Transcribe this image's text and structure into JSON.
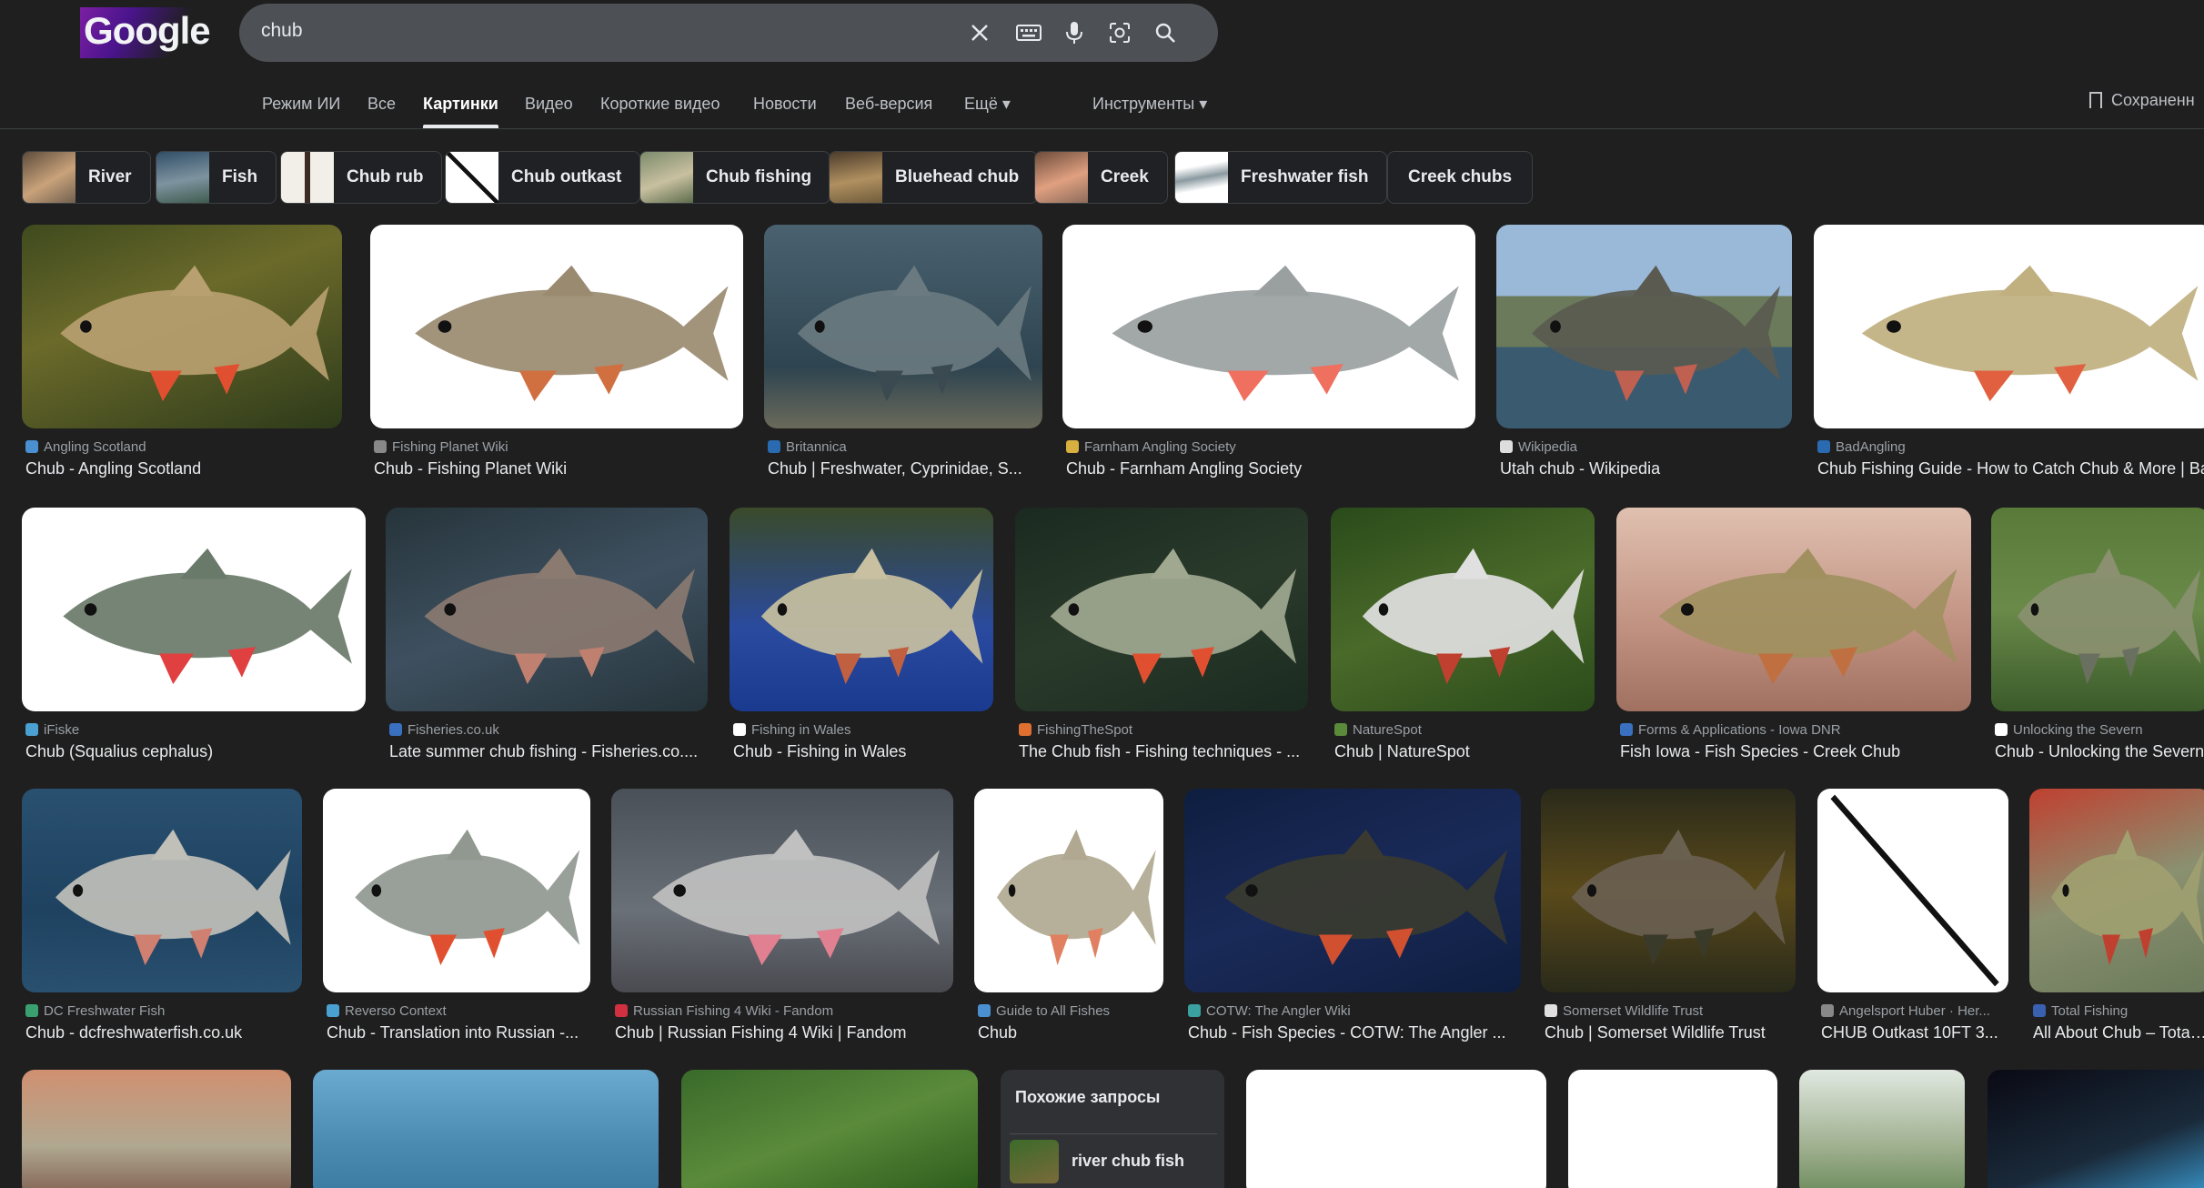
{
  "logo": {
    "text": "Google"
  },
  "search": {
    "query": "chub"
  },
  "tabs": [
    {
      "label": "Режим ИИ"
    },
    {
      "label": "Все"
    },
    {
      "label": "Картинки"
    },
    {
      "label": "Видео"
    },
    {
      "label": "Короткие видео"
    },
    {
      "label": "Новости"
    },
    {
      "label": "Веб-версия"
    },
    {
      "label": "Ещё ▾"
    },
    {
      "label": "Инструменты ▾"
    }
  ],
  "saved_label": "Сохраненн",
  "chips": [
    {
      "label": "River"
    },
    {
      "label": "Fish"
    },
    {
      "label": "Chub rub"
    },
    {
      "label": "Chub outkast"
    },
    {
      "label": "Chub fishing"
    },
    {
      "label": "Bluehead chub"
    },
    {
      "label": "Creek"
    },
    {
      "label": "Freshwater fish"
    },
    {
      "label": "Creek chubs"
    }
  ],
  "results": [
    {
      "source": "Angling Scotland",
      "title": "Chub - Angling Scotland"
    },
    {
      "source": "Fishing Planet Wiki",
      "title": "Chub - Fishing Planet Wiki"
    },
    {
      "source": "Britannica",
      "title": "Chub | Freshwater, Cyprinidae, S..."
    },
    {
      "source": "Farnham Angling Society",
      "title": "Chub - Farnham Angling Society"
    },
    {
      "source": "Wikipedia",
      "title": "Utah chub - Wikipedia"
    },
    {
      "source": "BadAngling",
      "title": "Chub Fishing Guide - How to Catch Chub & More | Ba"
    },
    {
      "source": "iFiske",
      "title": "Chub (Squalius cephalus)"
    },
    {
      "source": "Fisheries.co.uk",
      "title": "Late summer chub fishing - Fisheries.co...."
    },
    {
      "source": "Fishing in Wales",
      "title": "Chub - Fishing in Wales"
    },
    {
      "source": "FishingTheSpot",
      "title": "The Chub fish - Fishing techniques - ..."
    },
    {
      "source": "NatureSpot",
      "title": "Chub | NatureSpot"
    },
    {
      "source": "Forms & Applications - Iowa DNR",
      "title": "Fish Iowa - Fish Species - Creek Chub"
    },
    {
      "source": "Unlocking the Severn",
      "title": "Chub - Unlocking the Severn"
    },
    {
      "source": "DC Freshwater Fish",
      "title": "Chub - dcfreshwaterfish.co.uk"
    },
    {
      "source": "Reverso Context",
      "title": "Chub - Translation into Russian -..."
    },
    {
      "source": "Russian Fishing 4 Wiki - Fandom",
      "title": "Chub | Russian Fishing 4 Wiki | Fandom"
    },
    {
      "source": "Guide to All Fishes",
      "title": "Chub"
    },
    {
      "source": "COTW: The Angler Wiki",
      "title": "Chub - Fish Species - COTW: The Angler ..."
    },
    {
      "source": "Somerset Wildlife Trust",
      "title": "Chub | Somerset Wildlife Trust"
    },
    {
      "source": "Angelsport Huber · Her...",
      "title": "CHUB Outkast 10FT 3..."
    },
    {
      "source": "Total Fishing",
      "title": "All About Chub – Total F"
    }
  ],
  "related": {
    "heading": "Похожие запросы",
    "item": "river chub fish"
  },
  "colors": {
    "background": "#1f1f1f",
    "search_box": "#4d5156",
    "text": "#e8eaed",
    "muted": "#9aa0a6"
  }
}
